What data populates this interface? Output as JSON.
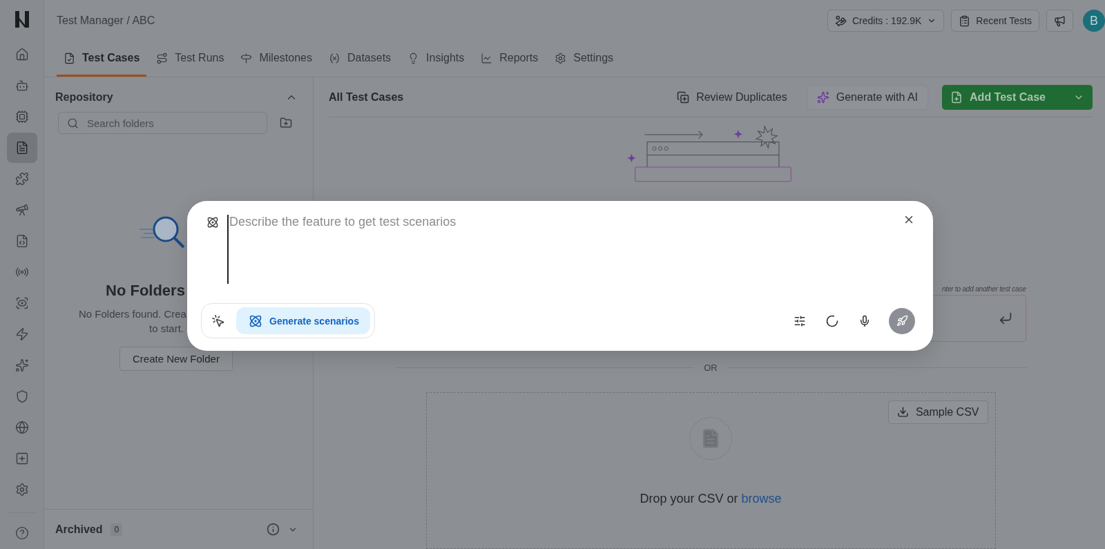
{
  "rail": [
    {
      "selected": false
    },
    {
      "selected": false
    },
    {
      "selected": false
    },
    {
      "selected": true
    },
    {
      "selected": false
    },
    {
      "selected": false
    },
    {
      "selected": false
    },
    {
      "selected": false
    },
    {
      "selected": false
    },
    {
      "selected": false
    },
    {
      "selected": false
    },
    {
      "selected": false
    },
    {
      "selected": false
    },
    {
      "selected": false
    },
    {
      "selected": false
    }
  ],
  "breadcrumb": "Test Manager / ABC",
  "header_actions": {
    "credits": "Credits : 192.9K",
    "recent": "Recent Tests",
    "avatar": "B"
  },
  "tabs": [
    {
      "label": "Test Cases",
      "selected": true
    },
    {
      "label": "Test Runs",
      "selected": false
    },
    {
      "label": "Milestones",
      "selected": false
    },
    {
      "label": "Datasets",
      "selected": false
    },
    {
      "label": "Insights",
      "selected": false
    },
    {
      "label": "Reports",
      "selected": false
    },
    {
      "label": "Settings",
      "selected": false
    }
  ],
  "repository": {
    "title": "Repository",
    "search_placeholder": "Search folders",
    "empty_title": "No Folders",
    "empty_line_1": "No Folders found. Crea",
    "empty_line_2": "to start.",
    "create_button": "Create New Folder",
    "archived": "Archived",
    "archived_count": "0"
  },
  "content": {
    "title": "All Test Cases",
    "review": "Review Duplicates",
    "generate_ai": "Generate with AI",
    "add": "Add Test Case",
    "hint": "nter to add another test case",
    "divider": "OR",
    "sample": "Sample CSV",
    "drop_text": "Drop your CSV or",
    "browse": "browse"
  },
  "modal": {
    "placeholder": "Describe the feature to get test scenarios",
    "generate": "Generate scenarios"
  }
}
